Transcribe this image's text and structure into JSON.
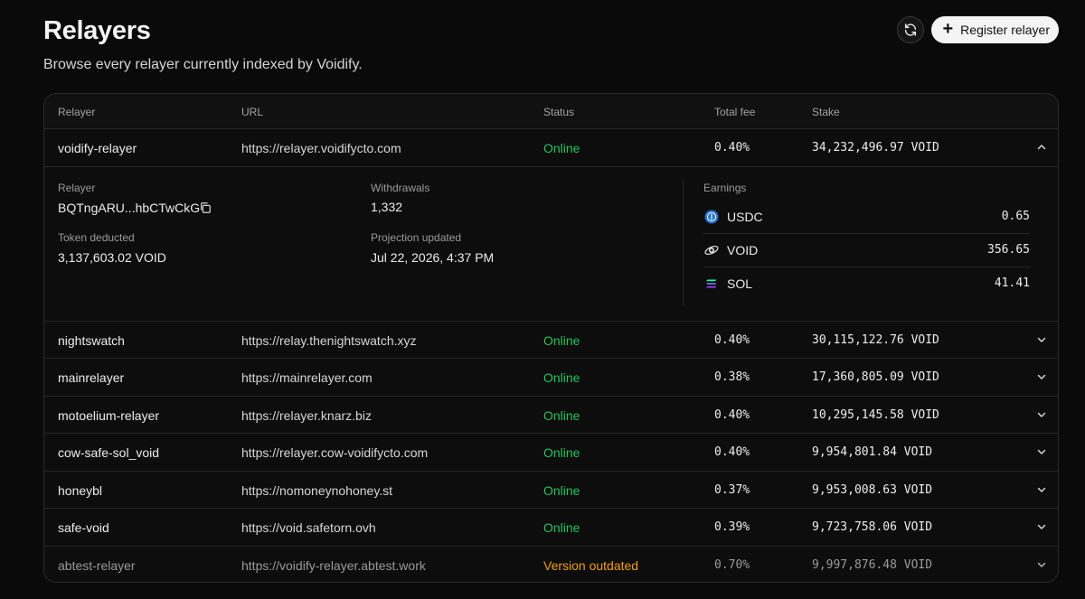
{
  "header": {
    "title": "Relayers",
    "subtitle": "Browse every relayer currently indexed by Voidify."
  },
  "toolbar": {
    "refresh_icon": "refresh-icon",
    "register_label": "Register relayer"
  },
  "table": {
    "columns": [
      "Relayer",
      "URL",
      "Status",
      "Total fee",
      "Stake"
    ]
  },
  "expanded": {
    "relayer_label": "Relayer",
    "relayer_value": "BQTngARU...hbCTwCkG",
    "withdrawals_label": "Withdrawals",
    "withdrawals_value": "1,332",
    "token_deducted_label": "Token deducted",
    "token_deducted_value": "3,137,603.02 VOID",
    "projection_label": "Projection updated",
    "projection_value": "Jul 22, 2026, 4:37 PM",
    "earnings_label": "Earnings",
    "earnings": [
      {
        "token": "USDC",
        "amount": "0.65",
        "icon": "usdc-icon"
      },
      {
        "token": "VOID",
        "amount": "356.65",
        "icon": "void-icon"
      },
      {
        "token": "SOL",
        "amount": "41.41",
        "icon": "sol-icon"
      }
    ]
  },
  "rows": [
    {
      "name": "voidify-relayer",
      "url": "https://relayer.voidifycto.com",
      "status": "Online",
      "fee": "0.40%",
      "stake": "34,232,496.97 VOID"
    },
    {
      "name": "nightswatch",
      "url": "https://relay.thenightswatch.xyz",
      "status": "Online",
      "fee": "0.40%",
      "stake": "30,115,122.76 VOID"
    },
    {
      "name": "mainrelayer",
      "url": "https://mainrelayer.com",
      "status": "Online",
      "fee": "0.38%",
      "stake": "17,360,805.09 VOID"
    },
    {
      "name": "motoelium-relayer",
      "url": "https://relayer.knarz.biz",
      "status": "Online",
      "fee": "0.40%",
      "stake": "10,295,145.58 VOID"
    },
    {
      "name": "cow-safe-sol_void",
      "url": "https://relayer.cow-voidifycto.com",
      "status": "Online",
      "fee": "0.40%",
      "stake": "9,954,801.84 VOID"
    },
    {
      "name": "honeybl",
      "url": "https://nomoneynohoney.st",
      "status": "Online",
      "fee": "0.37%",
      "stake": "9,953,008.63 VOID"
    },
    {
      "name": "safe-void",
      "url": "https://void.safetorn.ovh",
      "status": "Online",
      "fee": "0.39%",
      "stake": "9,723,758.06 VOID"
    },
    {
      "name": "abtest-relayer",
      "url": "https://voidify-relayer.abtest.work",
      "status": "Version outdated",
      "fee": "0.70%",
      "stake": "9,997,876.48 VOID"
    }
  ],
  "colors": {
    "online": "#22c55e",
    "outdated": "#f59e0b",
    "background": "#0a0a0a"
  }
}
